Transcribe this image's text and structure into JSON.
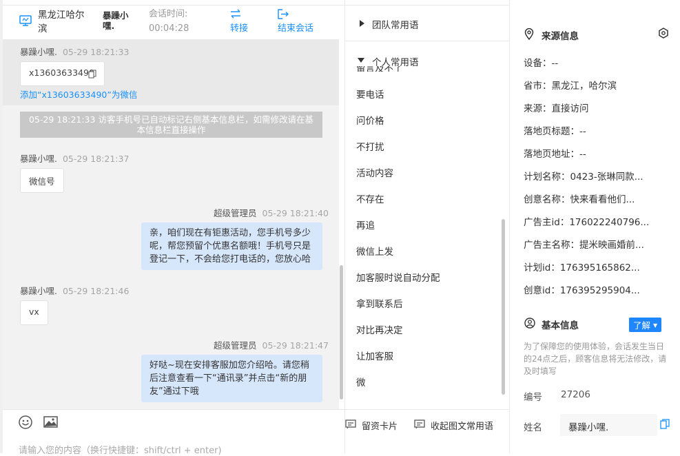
{
  "header": {
    "location": "黑龙江哈尔滨",
    "user": "暴躁小嘿.",
    "session_label": "会话时间:",
    "session_time": "00:04:28",
    "transfer": "转接",
    "end": "结束会话"
  },
  "messages": [
    {
      "sender": "暴躁小嘿.",
      "time": "05-29 18:21:33",
      "text": "x13603633490",
      "action": "添加“x13603633490”为微信"
    },
    {
      "system": "05-29 18:21:33 访客手机号已自动标记右侧基本信息栏，如需修改请在基本信息栏直接操作"
    },
    {
      "sender": "暴躁小嘿.",
      "time": "05-29 18:21:37",
      "text": "微信号"
    },
    {
      "sender": "超级管理员",
      "time": "05-29 18:21:40",
      "text": "亲，咱们现在有钜惠活动，您手机号多少呢，帮您预留个优惠名额哦！手机号只是登记一下，不会给您打电话的，您放心哈"
    },
    {
      "sender": "暴躁小嘿.",
      "time": "05-29 18:21:46",
      "text": "vx"
    },
    {
      "sender": "超级管理员",
      "time": "05-29 18:21:47",
      "text": "好哒~现在安排客服加您介绍哈。请您稍后注意查看一下“通讯录”并点击“新的朋友”通过下哦"
    }
  ],
  "composer": {
    "placeholder": "请输入您的内容（换行快捷键：shift/ctrl + enter)"
  },
  "phrases": {
    "team_group": "团队常用语",
    "personal_group": "个人常用语",
    "partial_item": "留言及不了",
    "items": [
      "要电话",
      "问价格",
      "不打扰",
      "活动内容",
      "不存在",
      "再追",
      "微信上发",
      "加客服时说自动分配",
      "拿到联系后",
      "对比再决定",
      "让加客服",
      "微"
    ],
    "card_label": "留资卡片",
    "collapse_label": "收起图文常用语"
  },
  "source_info": {
    "title": "来源信息",
    "rows": [
      "设备：--",
      "省市：黑龙江，哈尔滨",
      "来源：直接访问",
      "落地页标题：--",
      "落地页地址：--",
      "计划名称：0423-张琳同款...",
      "创意名称：快来看看他们...",
      "广告主id：176022240796...",
      "广告主名称：提米映画婚前...",
      "计划id：176395165862...",
      "创意id：176395295904..."
    ]
  },
  "basic_info": {
    "title": "基本信息",
    "know_label": "了解",
    "hint": "为了保障您的使用体验，会话发生当日的24点之后，顾客信息将无法修改，请及时填写",
    "id_label": "编号",
    "id_value": "27206",
    "name_label": "姓名",
    "name_value": "暴躁小嘿."
  },
  "colors": {
    "accent": "#1890ff",
    "bubble_agent": "#d6e6fb",
    "chat_bg": "#f2f2f2"
  }
}
